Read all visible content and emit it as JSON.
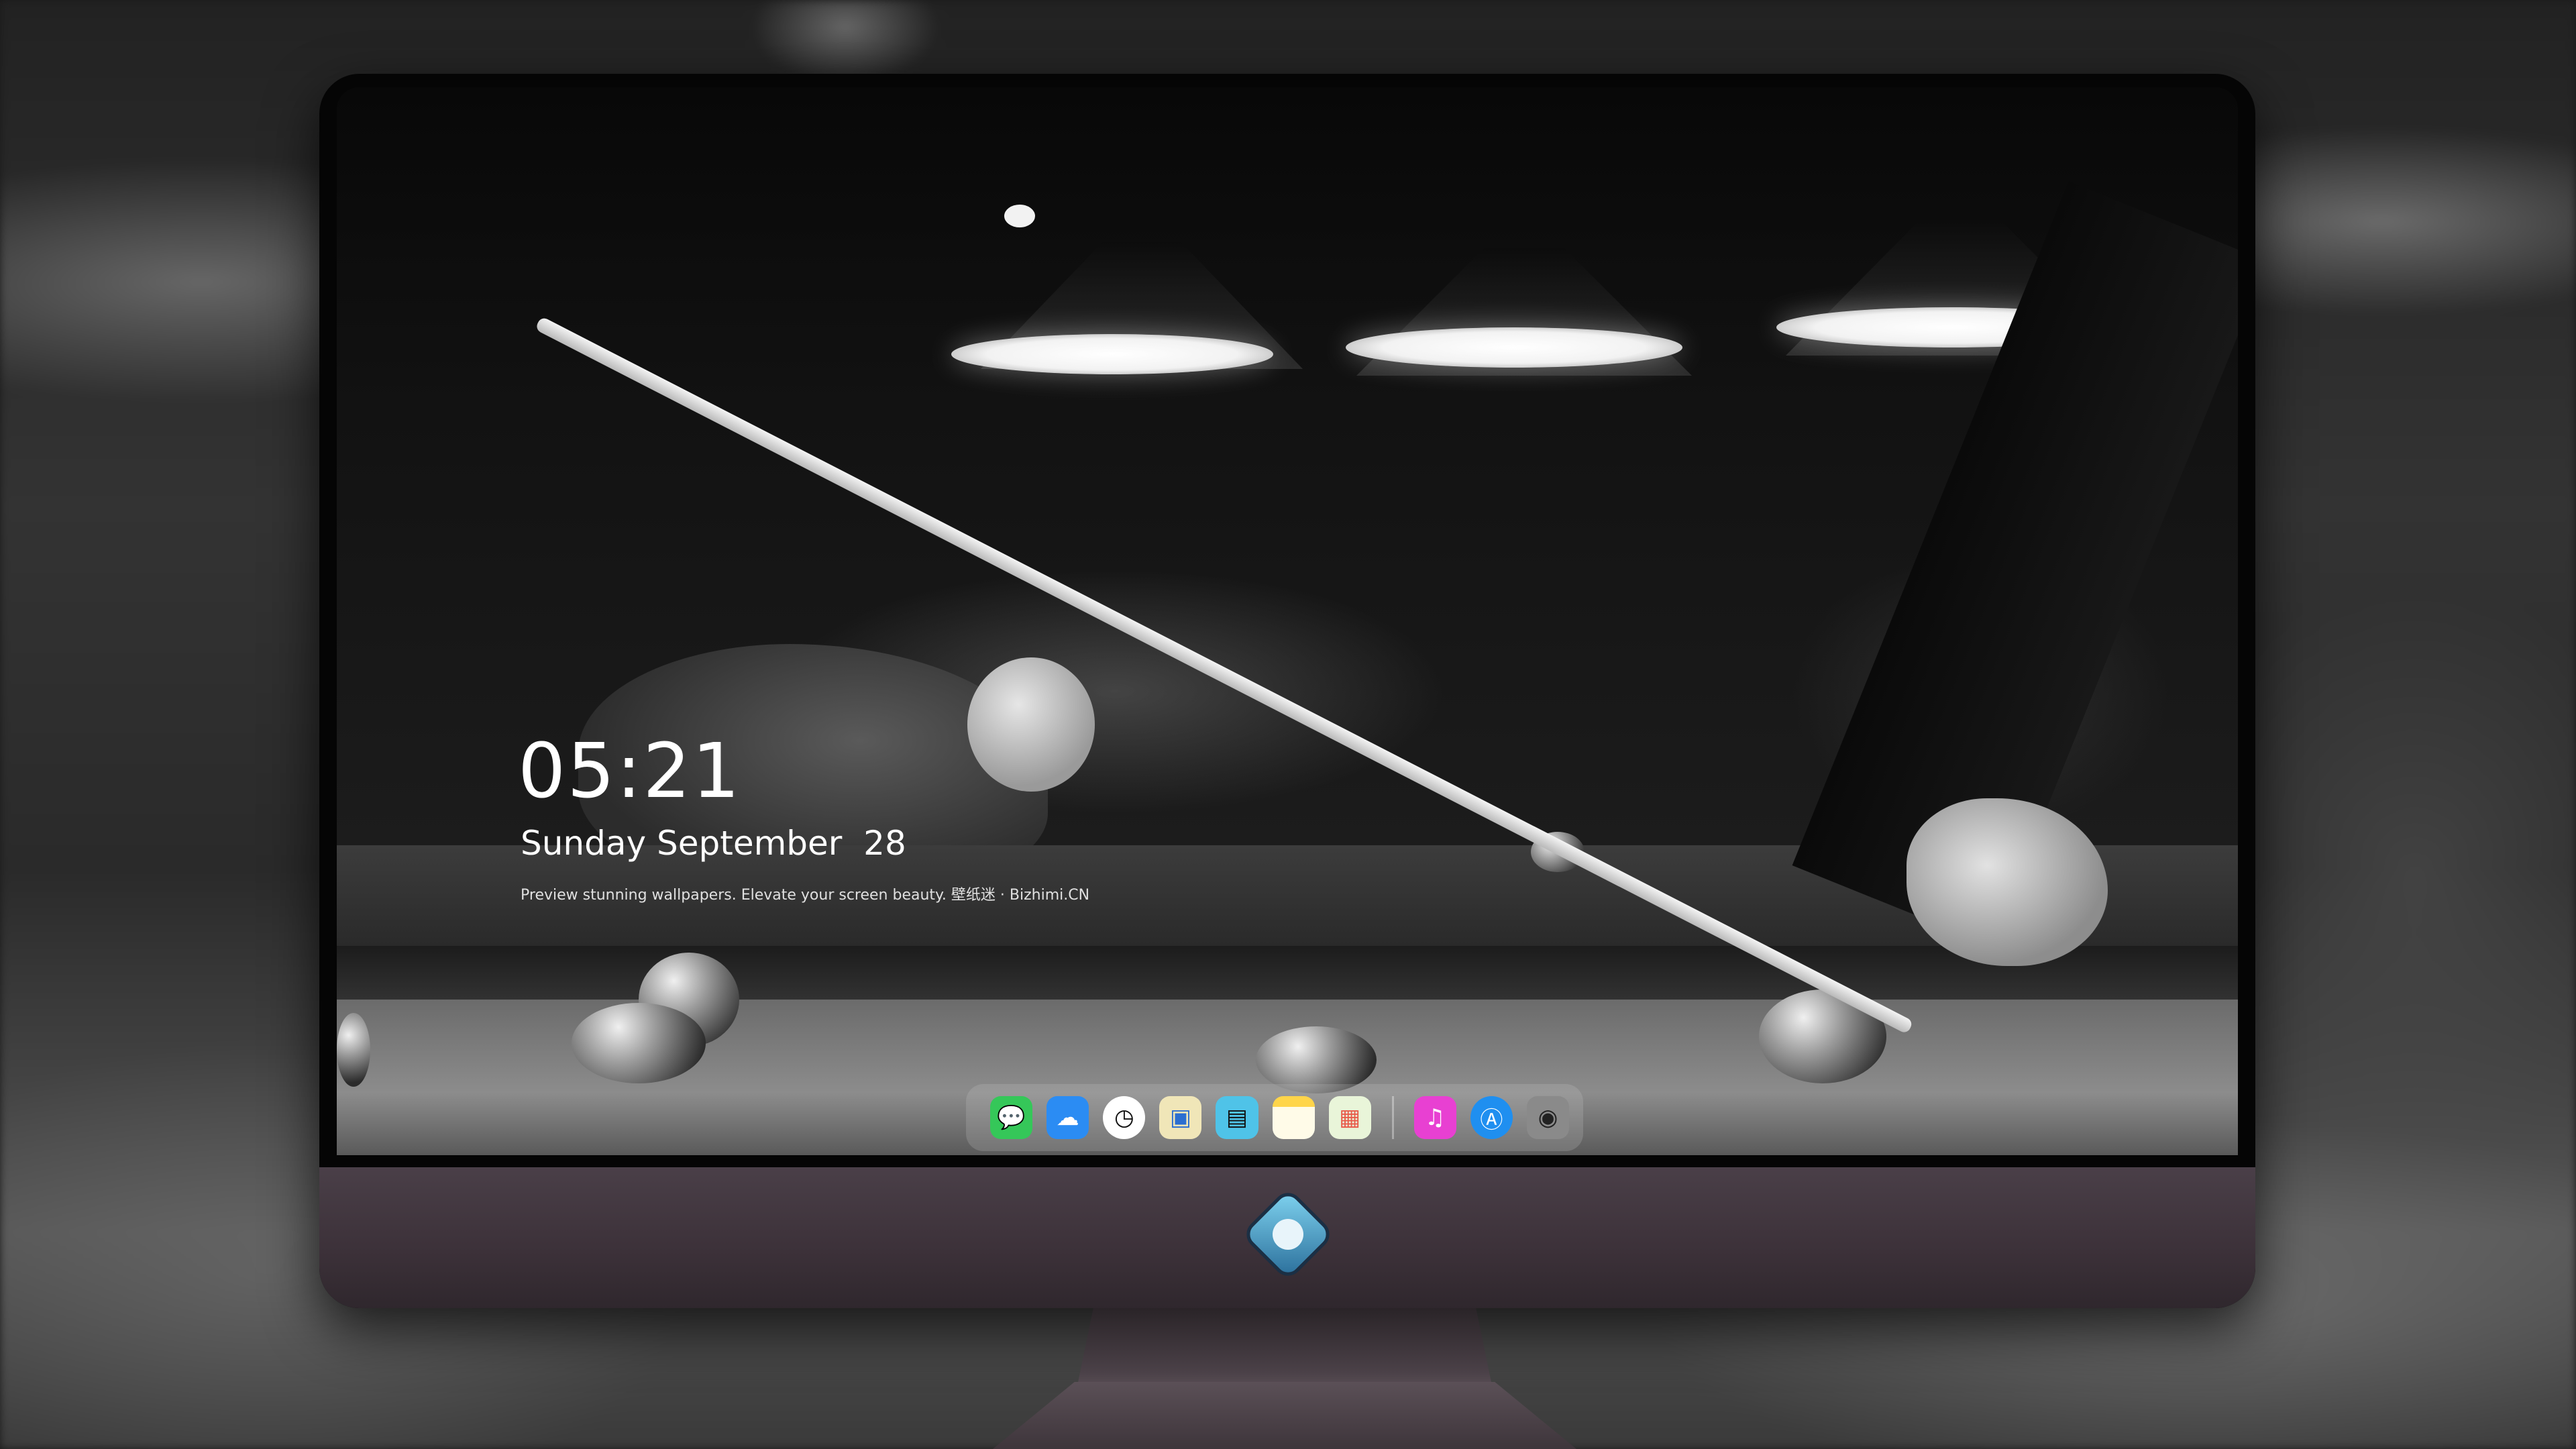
{
  "lock_screen": {
    "time": "05:21",
    "date": "Sunday September  28",
    "tagline": "Preview stunning wallpapers. Elevate your screen beauty. 壁纸迷 · Bizhimi.CN"
  },
  "dock": {
    "apps": [
      {
        "name": "messages-icon",
        "glyph": "💬",
        "color": "#35c759"
      },
      {
        "name": "weather-icon",
        "glyph": "☁",
        "color": "#2b8cf3"
      },
      {
        "name": "clock-icon",
        "glyph": "🕐",
        "color": "#ffffff"
      },
      {
        "name": "preview-icon",
        "glyph": "🖼",
        "color": "#f0e6b8"
      },
      {
        "name": "claquette-icon",
        "glyph": "🎬",
        "color": "#4fc3e8"
      },
      {
        "name": "notes-icon",
        "glyph": "🗒",
        "color": "#ffd54a"
      },
      {
        "name": "photos-icon",
        "glyph": "▦",
        "color": "#e9f5d9"
      },
      {
        "name": "music-icon",
        "glyph": "♫",
        "color": "#e840d2"
      },
      {
        "name": "app-store-icon",
        "glyph": "Ⓐ",
        "color": "#1f8ff0"
      },
      {
        "name": "camera-icon",
        "glyph": "📷",
        "color": "#8a8a8a"
      }
    ]
  }
}
